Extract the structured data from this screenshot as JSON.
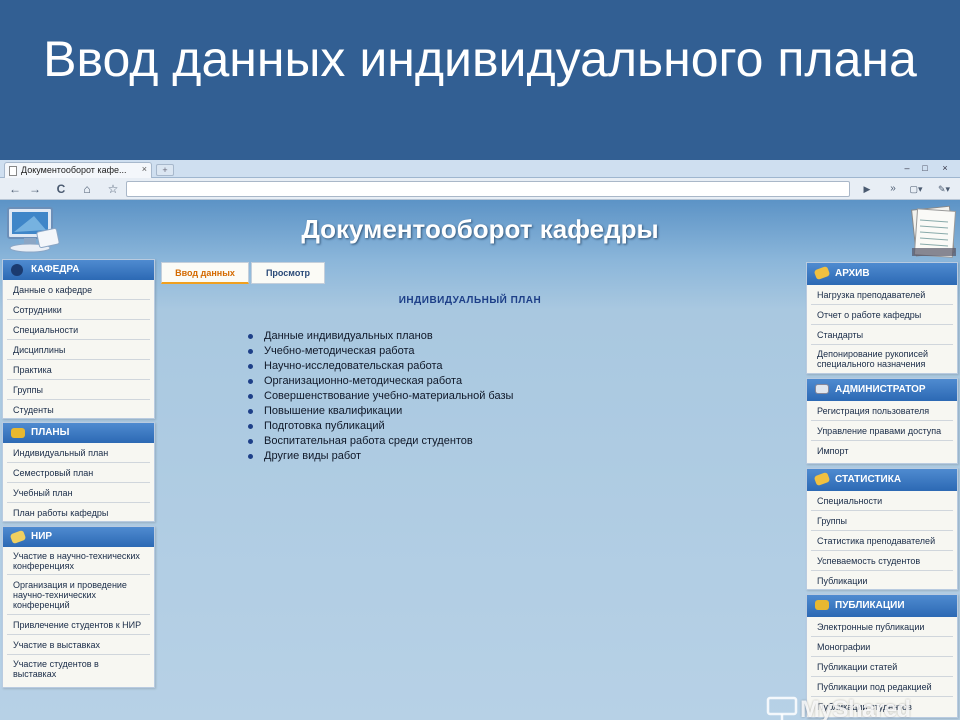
{
  "slide": {
    "title": "Ввод данных индивидуального плана"
  },
  "browser": {
    "tab_title": "Документооборот кафе...",
    "tab_close": "×",
    "new_tab": "+",
    "window_controls": [
      "–",
      "□",
      "×"
    ],
    "toolbar": {
      "back": "←",
      "forward": "→",
      "reload": "C",
      "home": "⌂",
      "bookmark": "☆",
      "go": "▶",
      "more": "»",
      "page_menu": "▢▾",
      "tools_menu": "✎▾"
    }
  },
  "site": {
    "header_title": "Документооборот кафедры",
    "left_panels": [
      {
        "title": "КАФЕДРА",
        "items": [
          "Данные о кафедре",
          "Сотрудники",
          "Специальности",
          "Дисциплины",
          "Практика",
          "Группы",
          "Студенты"
        ]
      },
      {
        "title": "ПЛАНЫ",
        "items": [
          "Индивидуальный план",
          "Семестровый план",
          "Учебный план",
          "План работы кафедры"
        ]
      },
      {
        "title": "НИР",
        "items": [
          "Участие в научно-технических конференциях",
          "Организация и проведение научно-технических конференций",
          "Привлечение студентов к НИР",
          "Участие в выставках",
          "Участие студентов в выставках"
        ]
      }
    ],
    "right_panels": [
      {
        "title": "АРХИВ",
        "items": [
          "Нагрузка преподавателей",
          "Отчет о работе кафедры",
          "Стандарты",
          "Депонирование рукописей специального назначения"
        ]
      },
      {
        "title": "АДМИНИСТРАТОР",
        "items": [
          "Регистрация пользователя",
          "Управление правами доступа",
          "Импорт"
        ]
      },
      {
        "title": "СТАТИСТИКА",
        "items": [
          "Специальности",
          "Группы",
          "Статистика преподавателей",
          "Успеваемость студентов",
          "Публикации"
        ]
      },
      {
        "title": "ПУБЛИКАЦИИ",
        "items": [
          "Электронные публикации",
          "Монографии",
          "Публикации статей",
          "Публикации под редакцией",
          "Публикации студентов"
        ]
      }
    ],
    "tabs": [
      {
        "label": "Ввод данных",
        "active": true
      },
      {
        "label": "Просмотр",
        "active": false
      }
    ],
    "plan_heading": "ИНДИВИДУАЛЬНЫЙ ПЛАН",
    "plan_items": [
      "Данные индивидуальных планов",
      "Учебно-методическая работа",
      "Научно-исследовательская работа",
      "Организационно-методическая работа",
      "Совершенствование учебно-материальной базы",
      "Повышение квалификации",
      "Подготовка публикаций",
      "Воспитательная работа среди студентов",
      "Другие виды работ"
    ]
  },
  "watermark": "MyShared",
  "colors": {
    "slide_bg": "#325f93",
    "panel_header": "#2c69b4",
    "active_tab_text": "#d46a00",
    "heading_blue": "#1d3f88"
  }
}
